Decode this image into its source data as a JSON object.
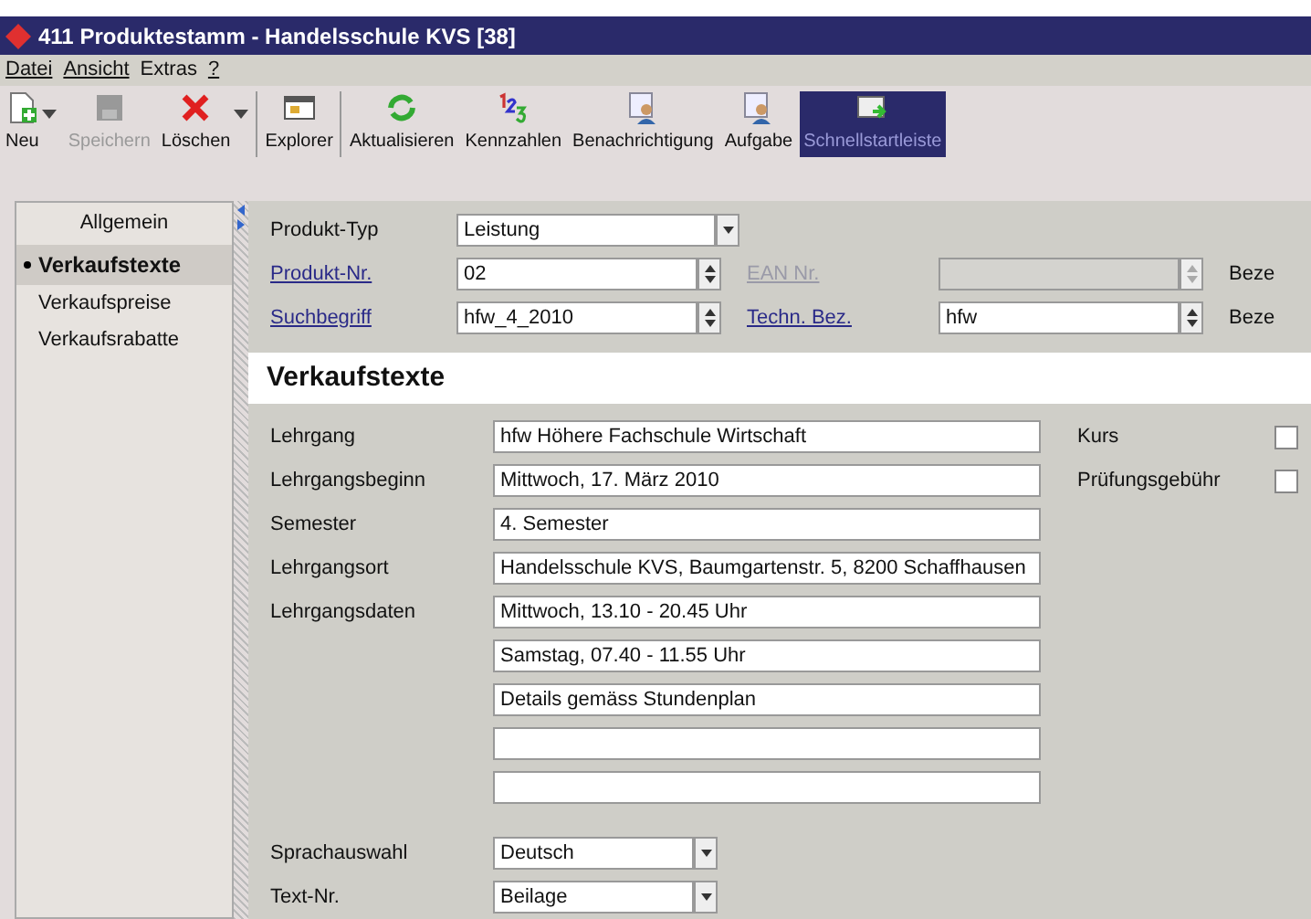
{
  "window": {
    "title": "411 Produktestamm - Handelsschule KVS [38]"
  },
  "menu": [
    {
      "label": "Datei",
      "mnemonic": true
    },
    {
      "label": "Ansicht",
      "mnemonic": true
    },
    {
      "label": "Extras",
      "mnemonic": false
    },
    {
      "label": "?",
      "mnemonic": true
    }
  ],
  "toolbar": [
    {
      "label": "Neu",
      "kind": "new",
      "dropdown": true,
      "disabled": false,
      "selected": false,
      "separator_after": false
    },
    {
      "label": "Speichern",
      "kind": "save",
      "dropdown": false,
      "disabled": true,
      "selected": false,
      "separator_after": false
    },
    {
      "label": "Löschen",
      "kind": "delete",
      "dropdown": true,
      "disabled": false,
      "selected": false,
      "separator_after": true
    },
    {
      "label": "Explorer",
      "kind": "window",
      "dropdown": false,
      "disabled": false,
      "selected": false,
      "separator_after": true
    },
    {
      "label": "Aktualisieren",
      "kind": "refresh",
      "dropdown": false,
      "disabled": false,
      "selected": false,
      "separator_after": false
    },
    {
      "label": "Kennzahlen",
      "kind": "numbers",
      "dropdown": false,
      "disabled": false,
      "selected": false,
      "separator_after": false
    },
    {
      "label": "Benachrichtigung",
      "kind": "person",
      "dropdown": false,
      "disabled": false,
      "selected": false,
      "separator_after": false
    },
    {
      "label": "Aufgabe",
      "kind": "person",
      "dropdown": false,
      "disabled": false,
      "selected": false,
      "separator_after": false
    },
    {
      "label": "Schnellstartleiste",
      "kind": "launch",
      "dropdown": false,
      "disabled": false,
      "selected": true,
      "separator_after": false
    }
  ],
  "sidebar": {
    "header": "Allgemein",
    "items": [
      {
        "label": "Verkaufstexte",
        "selected": true
      },
      {
        "label": "Verkaufspreise",
        "selected": false
      },
      {
        "label": "Verkaufsrabatte",
        "selected": false
      }
    ]
  },
  "header_rows": [
    [
      {
        "label": "Produkt-Typ",
        "link": false,
        "disabled": false,
        "kind": "combo",
        "value": "Leistung"
      }
    ],
    [
      {
        "label": "Produkt-Nr.",
        "link": true,
        "disabled": false,
        "kind": "spinner",
        "value": "02"
      },
      {
        "label": "EAN Nr.",
        "link": true,
        "disabled": true,
        "kind": "spinner"
      },
      {
        "label": "Beze",
        "link": false,
        "disabled": false,
        "kind": "label"
      }
    ],
    [
      {
        "label": "Suchbegriff",
        "link": true,
        "disabled": false,
        "kind": "spinner",
        "value": "hfw_4_2010"
      },
      {
        "label": "Techn. Bez.",
        "link": true,
        "disabled": false,
        "kind": "spinner",
        "value": "hfw"
      },
      {
        "label": "Beze",
        "link": false,
        "disabled": false,
        "kind": "label"
      }
    ]
  ],
  "section_title": "Verkaufstexte",
  "text_rows": [
    {
      "label": "Lehrgang",
      "value": "hfw Höhere Fachschule Wirtschaft"
    },
    {
      "label": "Lehrgangsbeginn",
      "value": "Mittwoch, 17. März 2010"
    },
    {
      "label": "Semester",
      "value": "4. Semester"
    },
    {
      "label": "Lehrgangsort",
      "value": "Handelsschule KVS, Baumgartenstr. 5, 8200 Schaffhausen"
    },
    {
      "label": "Lehrgangsdaten",
      "value": "Mittwoch, 13.10 - 20.45 Uhr"
    },
    {
      "value": "Samstag, 07.40 - 11.55 Uhr"
    },
    {
      "value": "Details gemäss Stundenplan"
    },
    {},
    {}
  ],
  "checkboxes": [
    {
      "label": "Kurs",
      "checked": false
    },
    {
      "label": "Prüfungsgebühr",
      "checked": false
    }
  ],
  "bottom_rows": [
    {
      "label": "Sprachauswahl",
      "value": "Deutsch"
    },
    {
      "label": "Text-Nr.",
      "value": "Beilage"
    }
  ]
}
